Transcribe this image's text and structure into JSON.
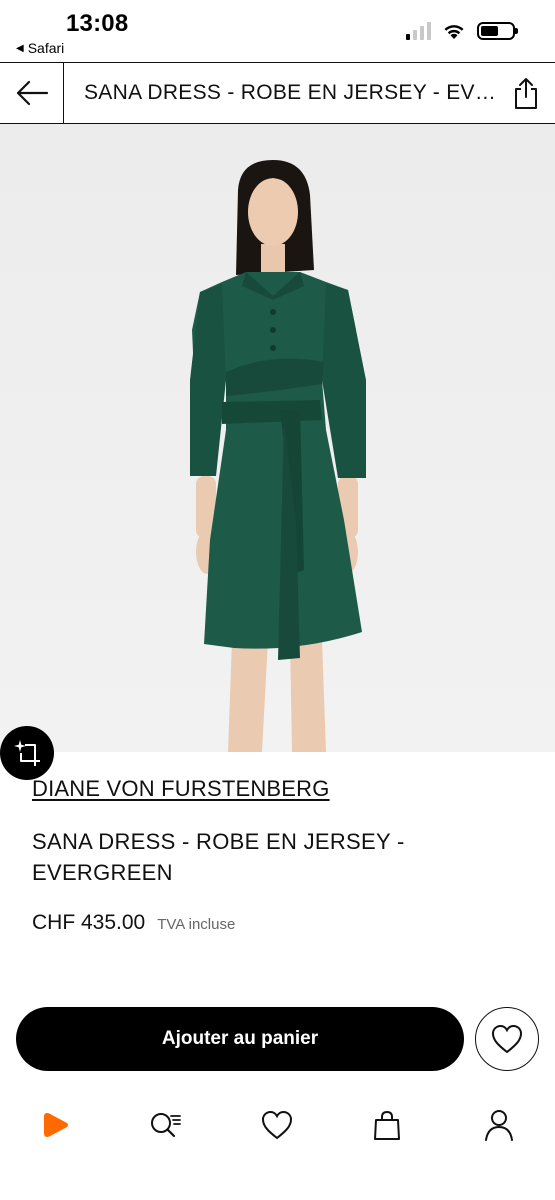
{
  "status_bar": {
    "time": "13:08",
    "back_app": "Safari",
    "back_icon": "back-triangle-icon",
    "icons": [
      "signal-icon",
      "wifi-icon",
      "battery-icon"
    ]
  },
  "header": {
    "title": "SANA DRESS - ROBE EN JERSEY - EVERGREEN",
    "back_icon": "arrow-left-icon",
    "share_icon": "share-icon"
  },
  "product": {
    "image_icon": "product-photo",
    "brand": "DIANE VON FURSTENBERG",
    "name": "SANA DRESS - ROBE EN JERSEY - EVERGREEN",
    "price": "CHF 435.00",
    "vat_note": "TVA incluse",
    "dress_color": "#1d5a47"
  },
  "actions": {
    "add_to_cart_label": "Ajouter au panier",
    "wishlist_icon": "heart-icon",
    "visual_search_icon": "sparkle-crop-icon"
  },
  "tab_bar": {
    "items": [
      {
        "name": "home",
        "icon": "zalando-play-logo-icon"
      },
      {
        "name": "search",
        "icon": "search-list-icon"
      },
      {
        "name": "wishlist",
        "icon": "heart-icon"
      },
      {
        "name": "bag",
        "icon": "shopping-bag-icon"
      },
      {
        "name": "profile",
        "icon": "person-icon"
      }
    ]
  },
  "colors": {
    "accent": "#ff6900",
    "primary_button": "#000000",
    "image_background": "#efefef"
  }
}
